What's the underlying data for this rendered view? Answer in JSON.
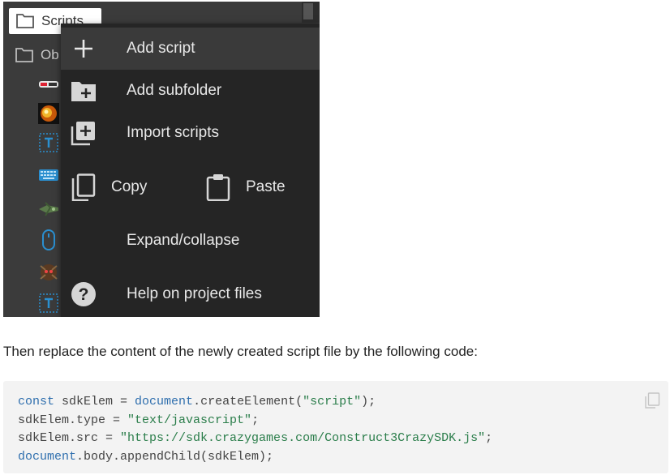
{
  "tree": {
    "selected_label": "Scripts",
    "second_label": "Ob"
  },
  "menu": {
    "add_script": "Add script",
    "add_subfolder": "Add subfolder",
    "import_scripts": "Import scripts",
    "copy": "Copy",
    "paste": "Paste",
    "expand_collapse": "Expand/collapse",
    "help": "Help on project files"
  },
  "doc": {
    "instruction": "Then replace the content of the newly created script file by the following code:",
    "code_lines": [
      [
        "const",
        " sdkElem = ",
        "document",
        ".createElement(",
        "\"script\"",
        ");"
      ],
      [
        "",
        "sdkElem.type = ",
        "",
        "",
        "\"text/javascript\"",
        ";"
      ],
      [
        "",
        "sdkElem.src = ",
        "",
        "",
        "\"https://sdk.crazygames.com/Construct3CrazySDK.js\"",
        ";"
      ],
      [
        "document",
        ".body.appendChild(sdkElem);",
        "",
        "",
        "",
        ""
      ]
    ]
  },
  "colors": {
    "menu_bg": "#252525",
    "menu_highlight": "#3a3a3a",
    "keyword": "#2f6fae",
    "string": "#2a7d4a"
  }
}
